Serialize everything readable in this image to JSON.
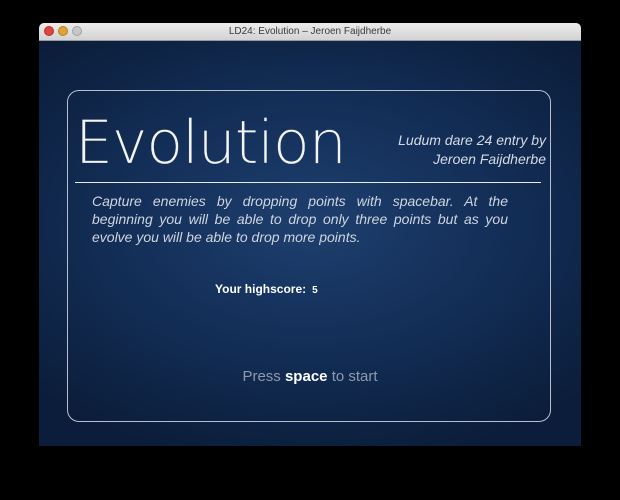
{
  "window": {
    "title": "LD24: Evolution – Jeroen Faijdherbe"
  },
  "game": {
    "title": "Evolution",
    "entry_line1": "Ludum dare 24 entry by",
    "entry_line2": "Jeroen Faijdherbe",
    "description": "Capture enemies by dropping points with spacebar. At the beginning you will be able to drop only three points but as you evolve you will be able to drop more points.",
    "highscore_label": "Your highscore:",
    "highscore_value": "5",
    "start_prefix": "Press",
    "start_key": "space",
    "start_suffix": "to start"
  },
  "colors": {
    "background": "#14305a",
    "text": "#ffffff",
    "muted": "#8e99ab"
  }
}
